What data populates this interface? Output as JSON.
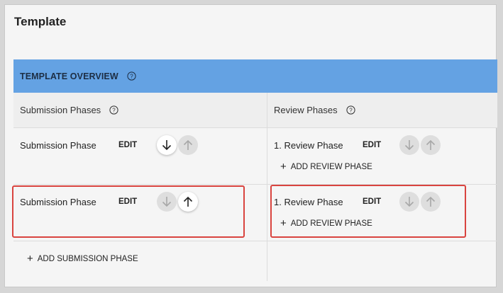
{
  "page": {
    "title": "Template"
  },
  "overview": {
    "label": "TEMPLATE OVERVIEW",
    "bar_color": "#64a2e3"
  },
  "columns": {
    "submission_header": "Submission Phases",
    "review_header": "Review Phases"
  },
  "rows": [
    {
      "submission": {
        "name": "Submission Phase",
        "edit": "EDIT",
        "down_enabled": true,
        "up_enabled": false
      },
      "review": {
        "name": "1. Review Phase",
        "edit": "EDIT",
        "down_enabled": false,
        "up_enabled": false,
        "add_label": "ADD REVIEW PHASE"
      }
    },
    {
      "submission": {
        "name": "Submission Phase",
        "edit": "EDIT",
        "down_enabled": false,
        "up_enabled": true
      },
      "review": {
        "name": "1. Review Phase",
        "edit": "EDIT",
        "down_enabled": false,
        "up_enabled": false,
        "add_label": "ADD REVIEW PHASE"
      }
    }
  ],
  "footer": {
    "add_submission_label": "ADD SUBMISSION PHASE"
  },
  "icons": {
    "help": "help-circle-icon",
    "down": "arrow-down-icon",
    "up": "arrow-up-icon",
    "plus": "plus-icon"
  },
  "colors": {
    "highlight": "#d9443f",
    "disabled_button": "#dedede"
  }
}
